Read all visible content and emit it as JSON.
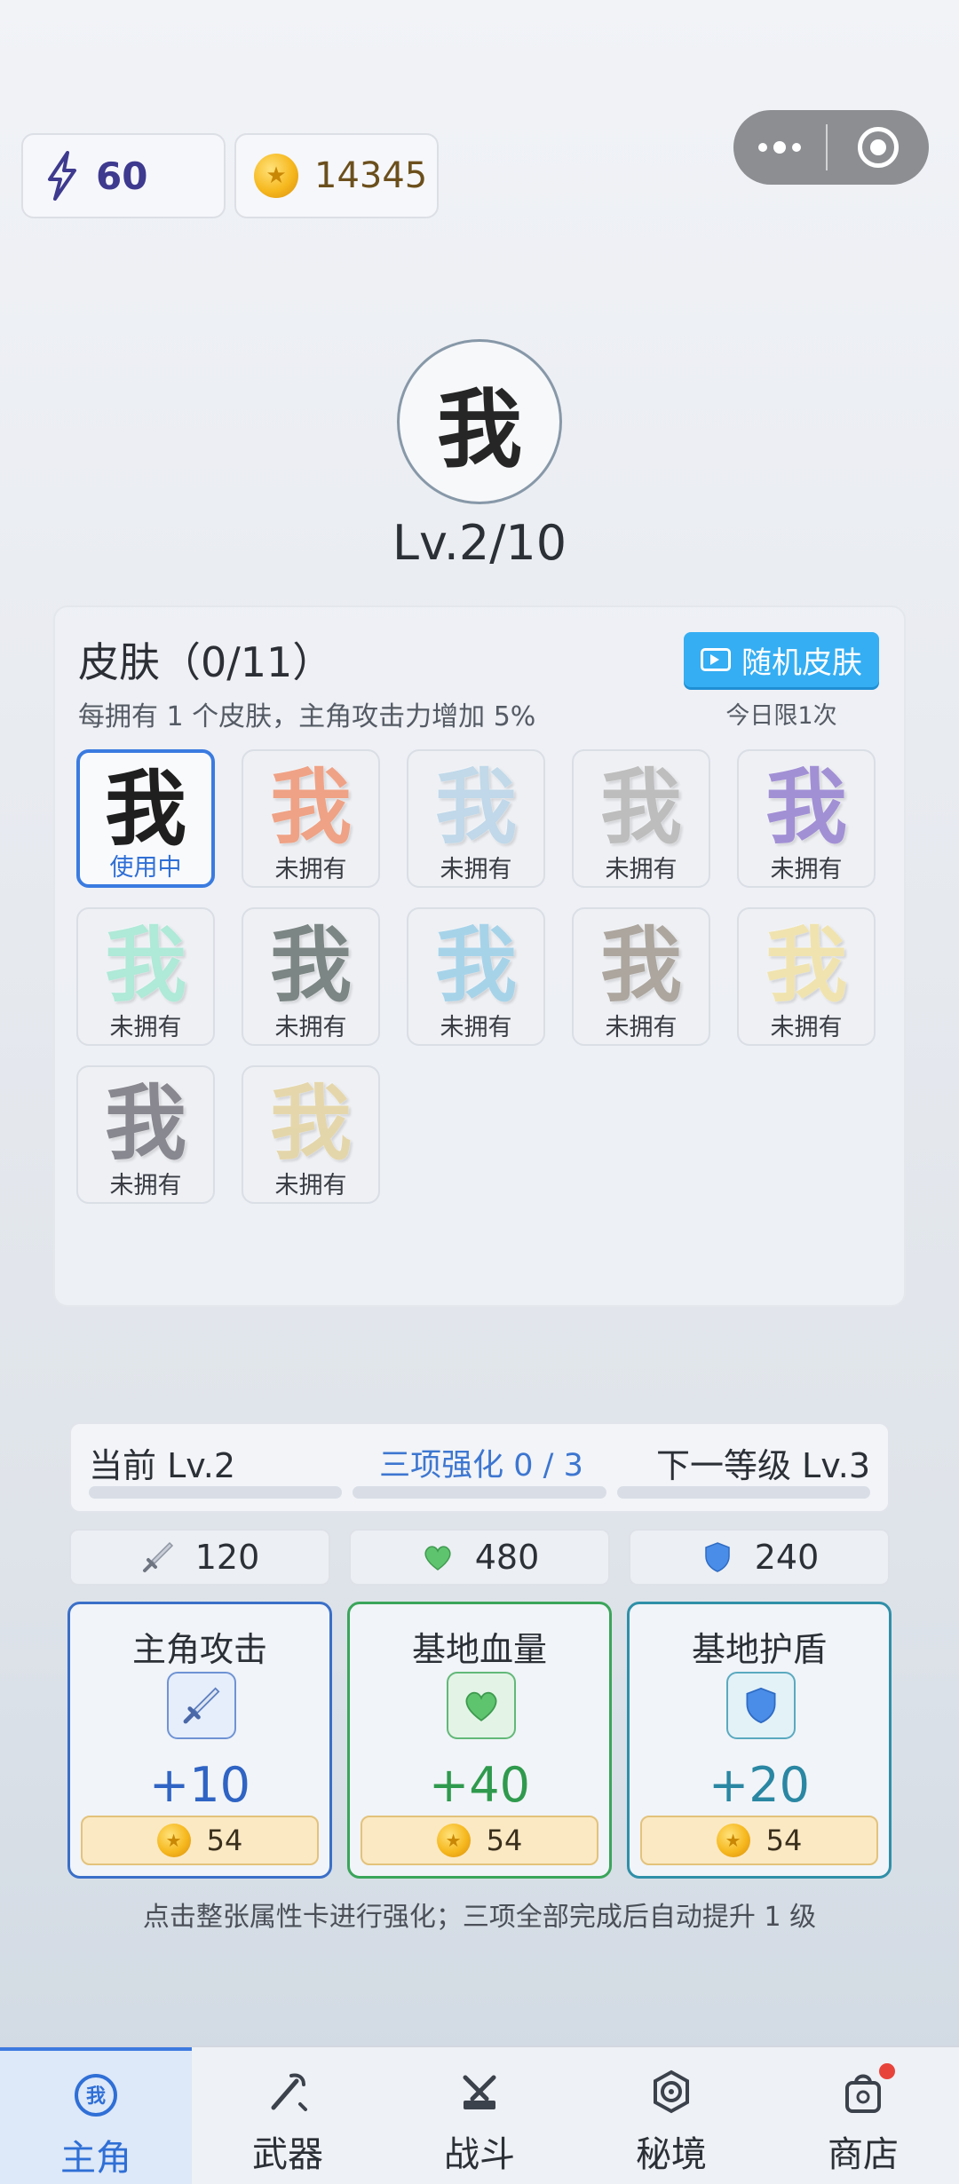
{
  "top": {
    "energy": "60",
    "coins": "14345",
    "energy_icon": "lightning-icon",
    "coin_icon": "gold-coin-icon",
    "menu_more_icon": "more-dots-icon",
    "menu_close_icon": "target-close-icon"
  },
  "hero": {
    "avatar_char": "我",
    "level": "Lv.2/10"
  },
  "skins": {
    "title": "皮肤（0/11）",
    "desc": "每拥有 1 个皮肤，主角攻击力增加 5%",
    "random_button": "随机皮肤",
    "today_limit": "今日限1次",
    "items": [
      {
        "char": "我",
        "label": "使用中",
        "color": "#1f1f1f",
        "active": true
      },
      {
        "char": "我",
        "label": "未拥有",
        "color": "#f09a7a"
      },
      {
        "char": "我",
        "label": "未拥有",
        "color": "#bcd6e8"
      },
      {
        "char": "我",
        "label": "未拥有",
        "color": "#b8b8b8"
      },
      {
        "char": "我",
        "label": "未拥有",
        "color": "#9a86d2"
      },
      {
        "char": "我",
        "label": "未拥有",
        "color": "#a8e8d4"
      },
      {
        "char": "我",
        "label": "未拥有",
        "color": "#6f7a78"
      },
      {
        "char": "我",
        "label": "未拥有",
        "color": "#9fd0e8"
      },
      {
        "char": "我",
        "label": "未拥有",
        "color": "#a59e96"
      },
      {
        "char": "我",
        "label": "未拥有",
        "color": "#f0e2a8"
      },
      {
        "char": "我",
        "label": "未拥有",
        "color": "#7e7d86"
      },
      {
        "char": "我",
        "label": "未拥有",
        "color": "#e4d4a4"
      }
    ]
  },
  "progress": {
    "current": "当前 Lv.2",
    "middle": "三项强化  0 / 3",
    "next": "下一等级 Lv.3",
    "filled_segments": 0,
    "total_segments": 3
  },
  "stats": {
    "attack": "120",
    "hp": "480",
    "shield": "240"
  },
  "cards": {
    "attack": {
      "title": "主角攻击",
      "bonus": "+10",
      "cost": "54",
      "icon": "sword-icon"
    },
    "hp": {
      "title": "基地血量",
      "bonus": "+40",
      "cost": "54",
      "icon": "heart-icon"
    },
    "shield": {
      "title": "基地护盾",
      "bonus": "+20",
      "cost": "54",
      "icon": "shield-icon"
    }
  },
  "hint": "点击整张属性卡进行强化；三项全部完成后自动提升 1 级",
  "tabs": [
    {
      "label": "主角",
      "icon": "hero-badge-icon",
      "active": true
    },
    {
      "label": "武器",
      "icon": "weapon-icon"
    },
    {
      "label": "战斗",
      "icon": "battle-icon"
    },
    {
      "label": "秘境",
      "icon": "realm-icon"
    },
    {
      "label": "商店",
      "icon": "shop-bag-icon",
      "badge": true
    }
  ],
  "colors": {
    "accent": "#3d7ae0",
    "random_button": "#35aef3",
    "attack": "#2f64c4",
    "hp": "#2f9a4d",
    "shield": "#2a87a3",
    "badge": "#e8433b"
  }
}
